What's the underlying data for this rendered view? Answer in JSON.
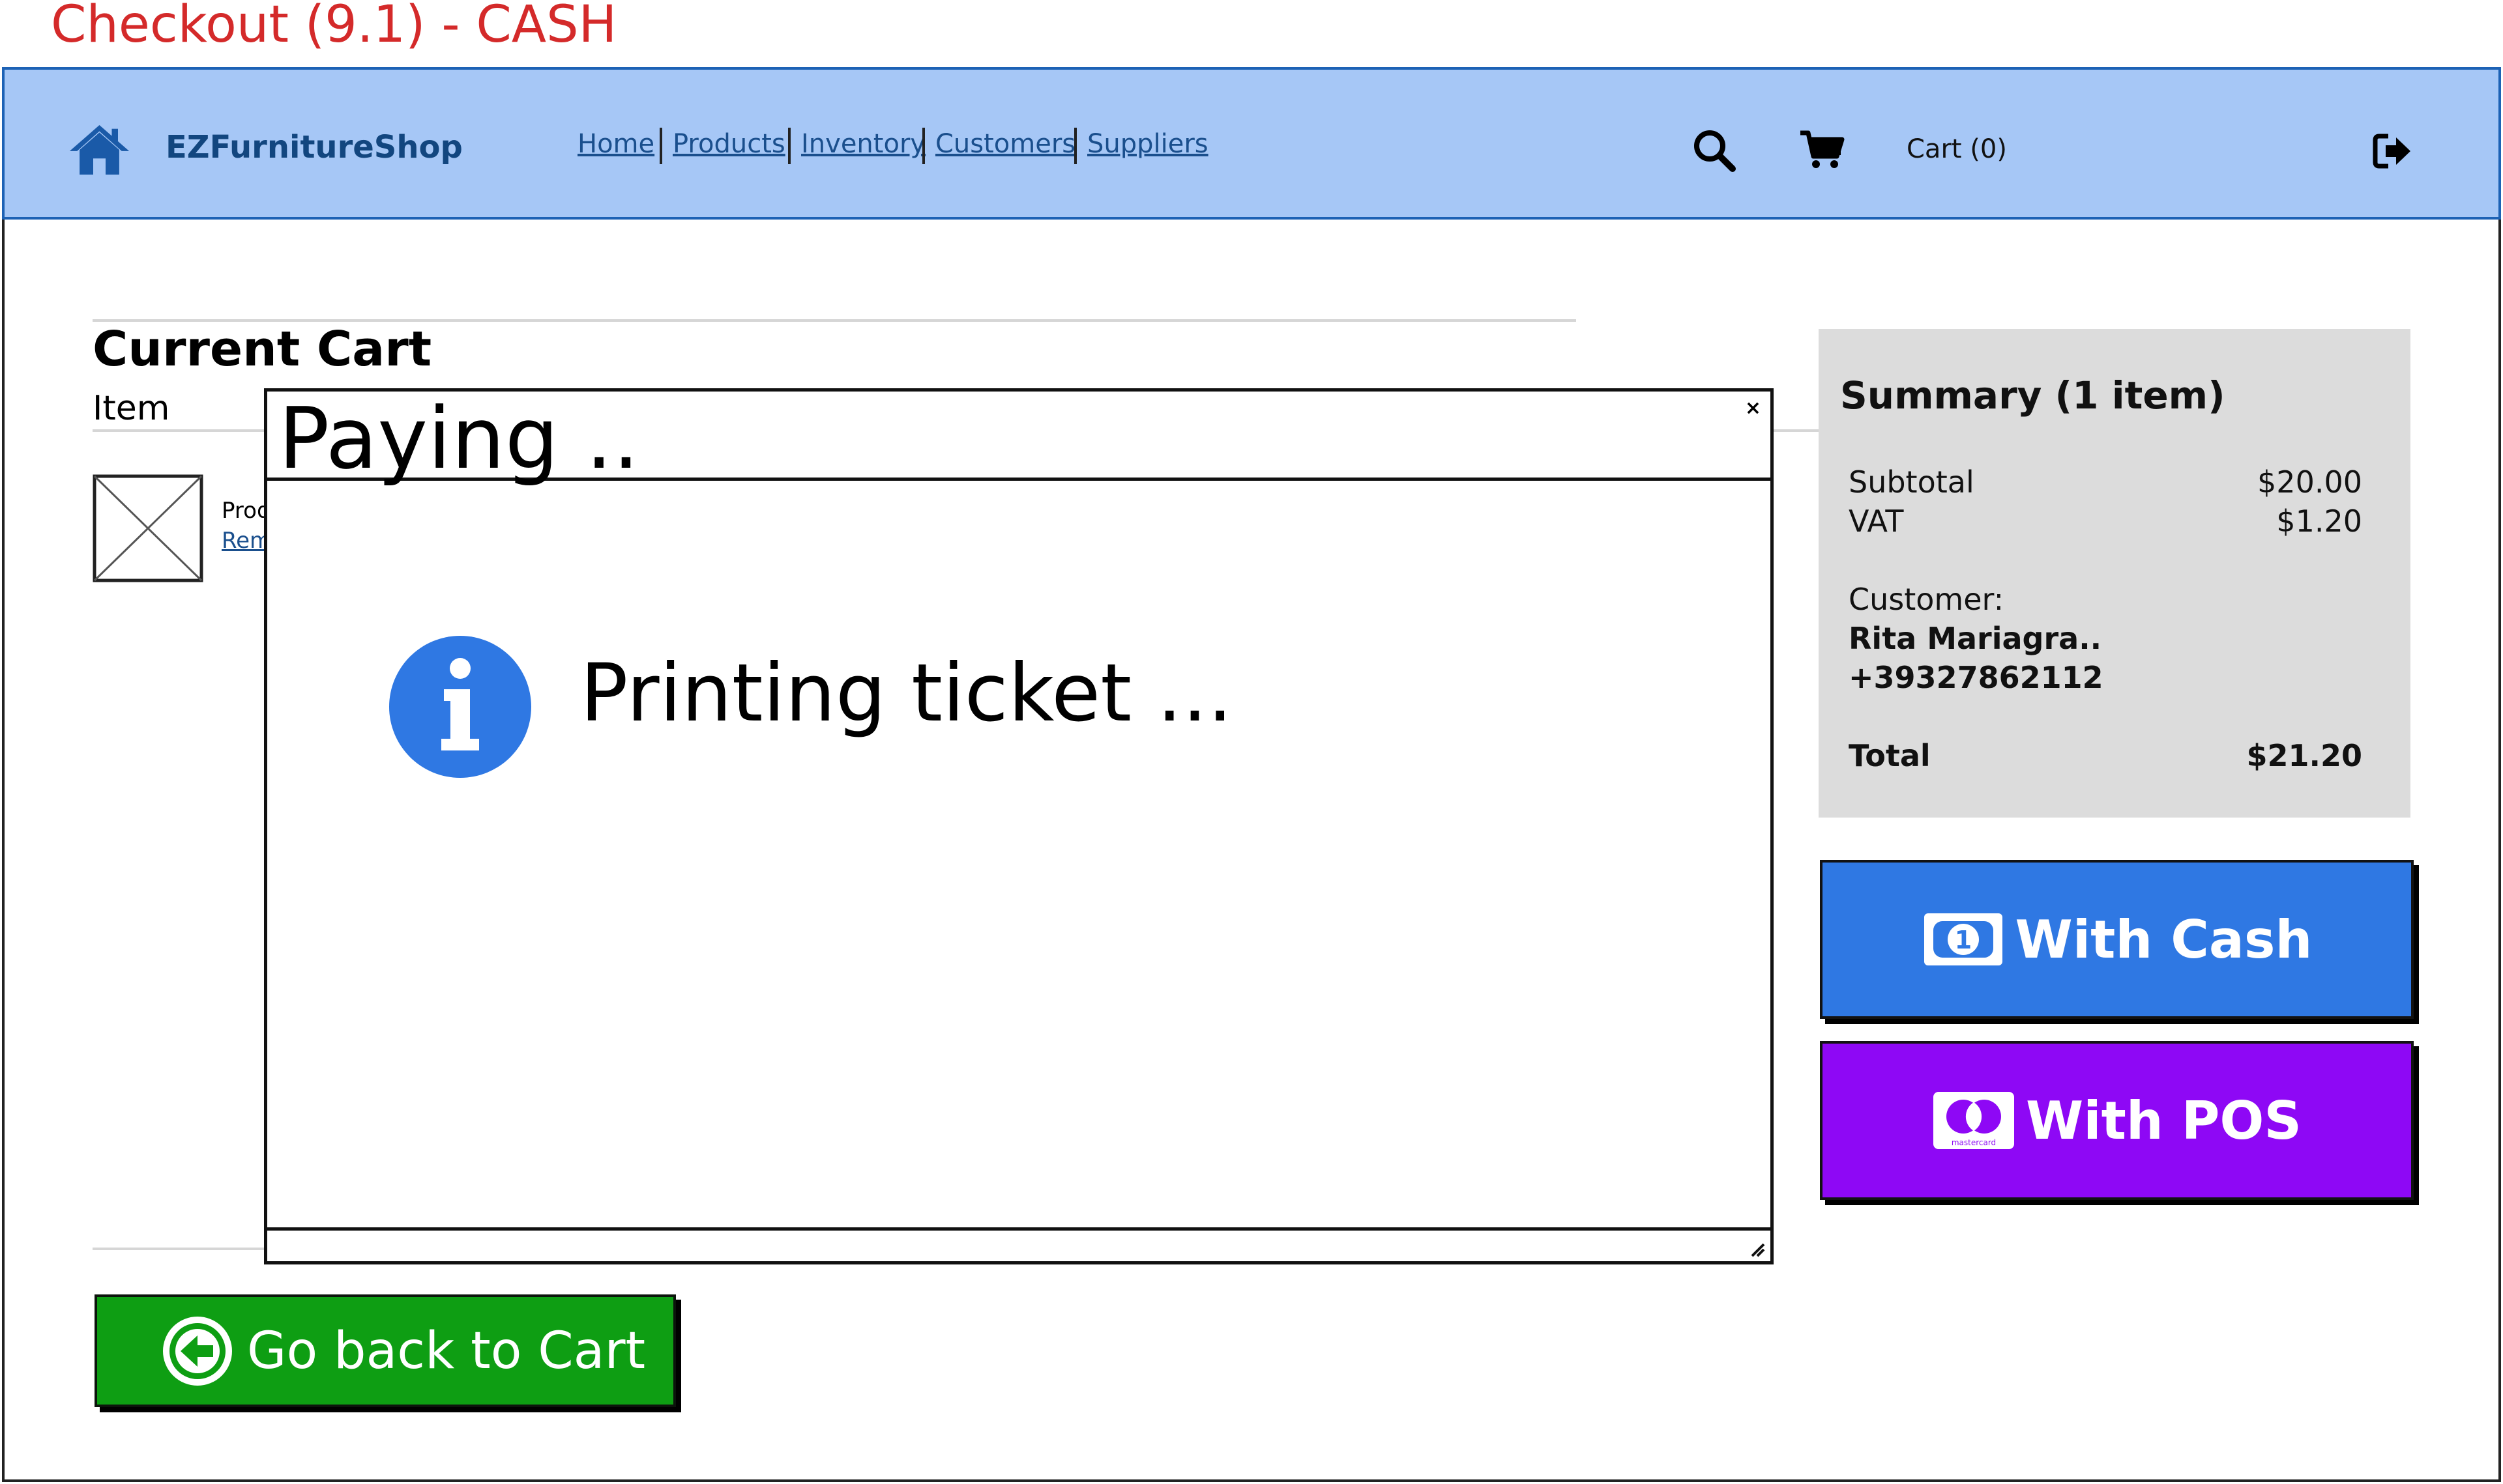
{
  "page_caption": "Checkout (9.1) - CASH",
  "navbar": {
    "brand": "EZFurnitureShop",
    "links": [
      "Home",
      "Products",
      "Inventory",
      "Customers",
      "Suppliers"
    ],
    "cart_label": "Cart (0)",
    "icons": [
      "home-icon",
      "search-icon",
      "cart-icon",
      "logout-icon"
    ]
  },
  "cart": {
    "title": "Current Cart",
    "item_header": "Item",
    "product_name_visible": "Prod",
    "remove_link_visible": "Rem"
  },
  "summary": {
    "title": "Summary (1 item)",
    "subtotal_label": "Subtotal",
    "subtotal_value": "$20.00",
    "vat_label": "VAT",
    "vat_value": "$1.20",
    "customer_label": "Customer:",
    "customer_name": "Rita Mariagra..",
    "customer_phone": "+39327862112",
    "total_label": "Total",
    "total_value": "$21.20"
  },
  "payment": {
    "cash_label": "With Cash",
    "pos_label": "With POS",
    "pos_card_text": "mastercard"
  },
  "back_button": {
    "label": "Go back to Cart"
  },
  "modal": {
    "title": "Paying ..",
    "close_glyph": "×",
    "message": "Printing ticket ..."
  },
  "colors": {
    "caption_red": "#d42a2a",
    "navbar_bg": "#a6c7f6",
    "brand_blue": "#12467f",
    "cash_blue": "#2f78e3",
    "pos_purple": "#8e08f5",
    "back_green": "#0e9e13",
    "summary_bg": "#dcdcdc",
    "info_blue": "#2f78e3"
  }
}
